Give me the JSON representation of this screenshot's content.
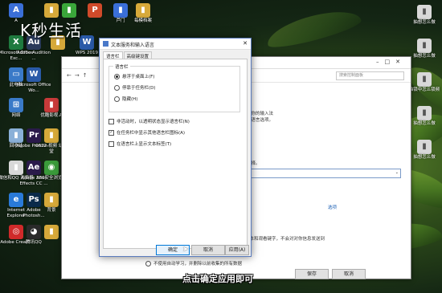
{
  "watermark": "K秒生活",
  "caption": "点击确定应用即可",
  "desktop_icons": [
    {
      "label": "A",
      "glyph": "A",
      "color": "#3a6fd8"
    },
    {
      "label": "",
      "glyph": "▮",
      "color": "#d6a93a"
    },
    {
      "label": "",
      "glyph": "▮",
      "color": "#3aa63a"
    },
    {
      "label": "",
      "glyph": "P",
      "color": "#d04a2a"
    },
    {
      "label": "芦门",
      "glyph": "▮",
      "color": "#3a6fd8"
    },
    {
      "label": "每模档案",
      "glyph": "▮",
      "color": "#d6a93a"
    },
    {
      "label": "Microsoft Office Exc...",
      "glyph": "X",
      "color": "#1f7a3f"
    },
    {
      "label": "Adobe Audition ...",
      "glyph": "Au",
      "color": "#2a3a5a"
    },
    {
      "label": "",
      "glyph": "▮",
      "color": "#d6a93a"
    },
    {
      "label": "WPS 2019",
      "glyph": "W",
      "color": "#2a5aa8"
    },
    {
      "label": "此电脑",
      "glyph": "▭",
      "color": "#3a7ac8"
    },
    {
      "label": "Microsoft Office Wo...",
      "glyph": "W",
      "color": "#2a5aa8"
    },
    {
      "label": "网络",
      "glyph": "⊞",
      "color": "#3a7ac8"
    },
    {
      "label": "优酷影视...",
      "glyph": "▮",
      "color": "#c83a3a"
    },
    {
      "label": "ARCTIME",
      "glyph": "A",
      "color": "#b8262a"
    },
    {
      "label": "回收站",
      "glyph": "▮",
      "color": "#8ab0d8"
    },
    {
      "label": "Adobe Premie...",
      "glyph": "Pr",
      "color": "#2a1a4a"
    },
    {
      "label": "0622-视频 幼食堂",
      "glyph": "▮",
      "color": "#d6a93a"
    },
    {
      "label": "微信和QQ 消费器",
      "glyph": "▮",
      "color": "#d8d8d8"
    },
    {
      "label": "Adobe After Effects CC ...",
      "glyph": "Ae",
      "color": "#2a1a4a"
    },
    {
      "label": "360安全浏览器",
      "glyph": "◉",
      "color": "#3a9a3a"
    },
    {
      "label": "Internet Explorer",
      "glyph": "e",
      "color": "#2a7ad8"
    },
    {
      "label": "Adobe Photosh...",
      "glyph": "Ps",
      "color": "#0a2a4a"
    },
    {
      "label": "背景",
      "glyph": "▮",
      "color": "#d6a93a"
    },
    {
      "label": "Adobe Creat...",
      "glyph": "◎",
      "color": "#d02a2a"
    },
    {
      "label": "腾讯QQ",
      "glyph": "◕",
      "color": "#2a2a2a"
    },
    {
      "label": "",
      "glyph": "▮",
      "color": "#d6a93a"
    }
  ],
  "right_icons": [
    {
      "label": "抽想怎么做",
      "glyph": "▮",
      "color": "#d8d8d8"
    },
    {
      "label": "抽想怎么做",
      "glyph": "▮",
      "color": "#d8d8d8"
    },
    {
      "label": "抽锁中怎么锁频",
      "glyph": "▮",
      "color": "#d8d8d8"
    },
    {
      "label": "抽想怎么做",
      "glyph": "▮",
      "color": "#d8d8d8"
    },
    {
      "label": "抽想怎么做",
      "glyph": "▮",
      "color": "#d8d8d8"
    }
  ],
  "bg_window": {
    "search_placeholder": "搜索控制面板",
    "text1": "，你的输入法",
    "text2": "，语言选项。",
    "text3": "选择。",
    "link": "选项",
    "text4": "文本和观看键字，不会对对你信息发送到",
    "save": "保存",
    "cancel": "取消"
  },
  "dialog": {
    "title": "文本服务和输入语言",
    "tabs": [
      "语言栏",
      "高级键设置"
    ],
    "group_title": "语言栏",
    "radios": [
      {
        "label": "悬浮于桌面上(F)",
        "checked": true
      },
      {
        "label": "停靠于任务栏(D)",
        "checked": false
      },
      {
        "label": "隐藏(H)",
        "checked": false
      }
    ],
    "checks": [
      {
        "label": "非活动时，以透明状态显示语言栏(N)",
        "checked": false
      },
      {
        "label": "在任务栏中显示其他语言栏图标(A)",
        "checked": true
      },
      {
        "label": "在语言栏上显示文本标签(T)",
        "checked": false
      }
    ],
    "ok": "确定",
    "cancel": "取消",
    "apply": "应用(A)"
  },
  "footer_radio": "不使用自动学习，并删除以前收集的所有数据"
}
